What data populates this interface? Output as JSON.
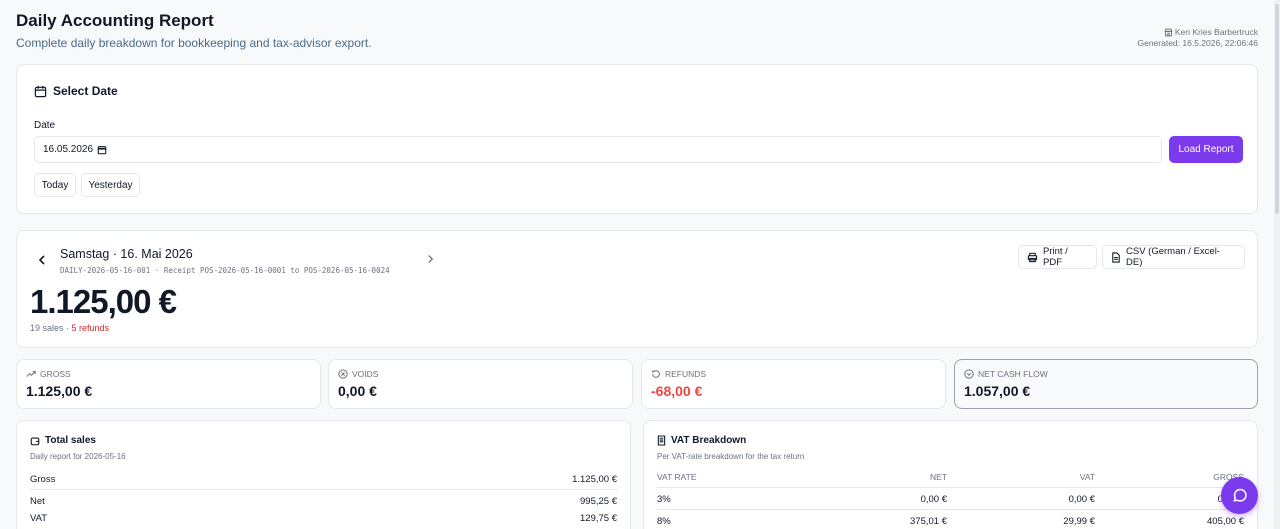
{
  "header": {
    "title": "Daily Accounting Report",
    "subtitle": "Complete daily breakdown for bookkeeping and tax-advisor export.",
    "user": "Ken Kries Barbertruck",
    "generated": "Generated: 16.5.2026, 22:06:46"
  },
  "select_date": {
    "title": "Select Date",
    "date_label": "Date",
    "date_value": "16.05.2026",
    "load_button": "Load Report",
    "today_button": "Today",
    "yesterday_button": "Yesterday"
  },
  "day": {
    "title": "Samstag · 16. Mai 2026",
    "reference": "DAILY-2026-05-16-001 · Receipt POS-2026-05-16-0001 to POS-2026-05-16-0024",
    "total": "1.125,00 €",
    "sales_count": "19 sales",
    "separator": " · ",
    "refunds_count": "5 refunds",
    "print_button": "Print / PDF",
    "csv_button": "CSV (German / Excel-DE)"
  },
  "stats": {
    "gross": {
      "label": "GROSS",
      "value": "1.125,00 €"
    },
    "voids": {
      "label": "VOIDS",
      "value": "0,00 €"
    },
    "refunds": {
      "label": "REFUNDS",
      "value": "-68,00 €"
    },
    "net_cash_flow": {
      "label": "NET CASH FLOW",
      "value": "1.057,00 €"
    }
  },
  "total_sales": {
    "title": "Total sales",
    "subtitle": "Daily report for 2026-05-16",
    "rows": [
      {
        "label": "Gross",
        "value": "1.125,00 €"
      },
      {
        "label": "Net",
        "value": "995,25 €"
      },
      {
        "label": "VAT",
        "value": "129,75 €"
      }
    ]
  },
  "vat": {
    "title": "VAT Breakdown",
    "subtitle": "Per VAT-rate breakdown for the tax return",
    "headers": {
      "rate": "VAT RATE",
      "net": "NET",
      "vat": "VAT",
      "gross": "GROSS"
    },
    "rows": [
      {
        "rate": "3%",
        "net": "0,00 €",
        "vat": "0,00 €",
        "gross": "0,00 €"
      },
      {
        "rate": "8%",
        "net": "375,01 €",
        "vat": "29,99 €",
        "gross": "405,00 €"
      }
    ]
  },
  "colors": {
    "accent": "#7c3aed",
    "negative": "#ef4444"
  }
}
